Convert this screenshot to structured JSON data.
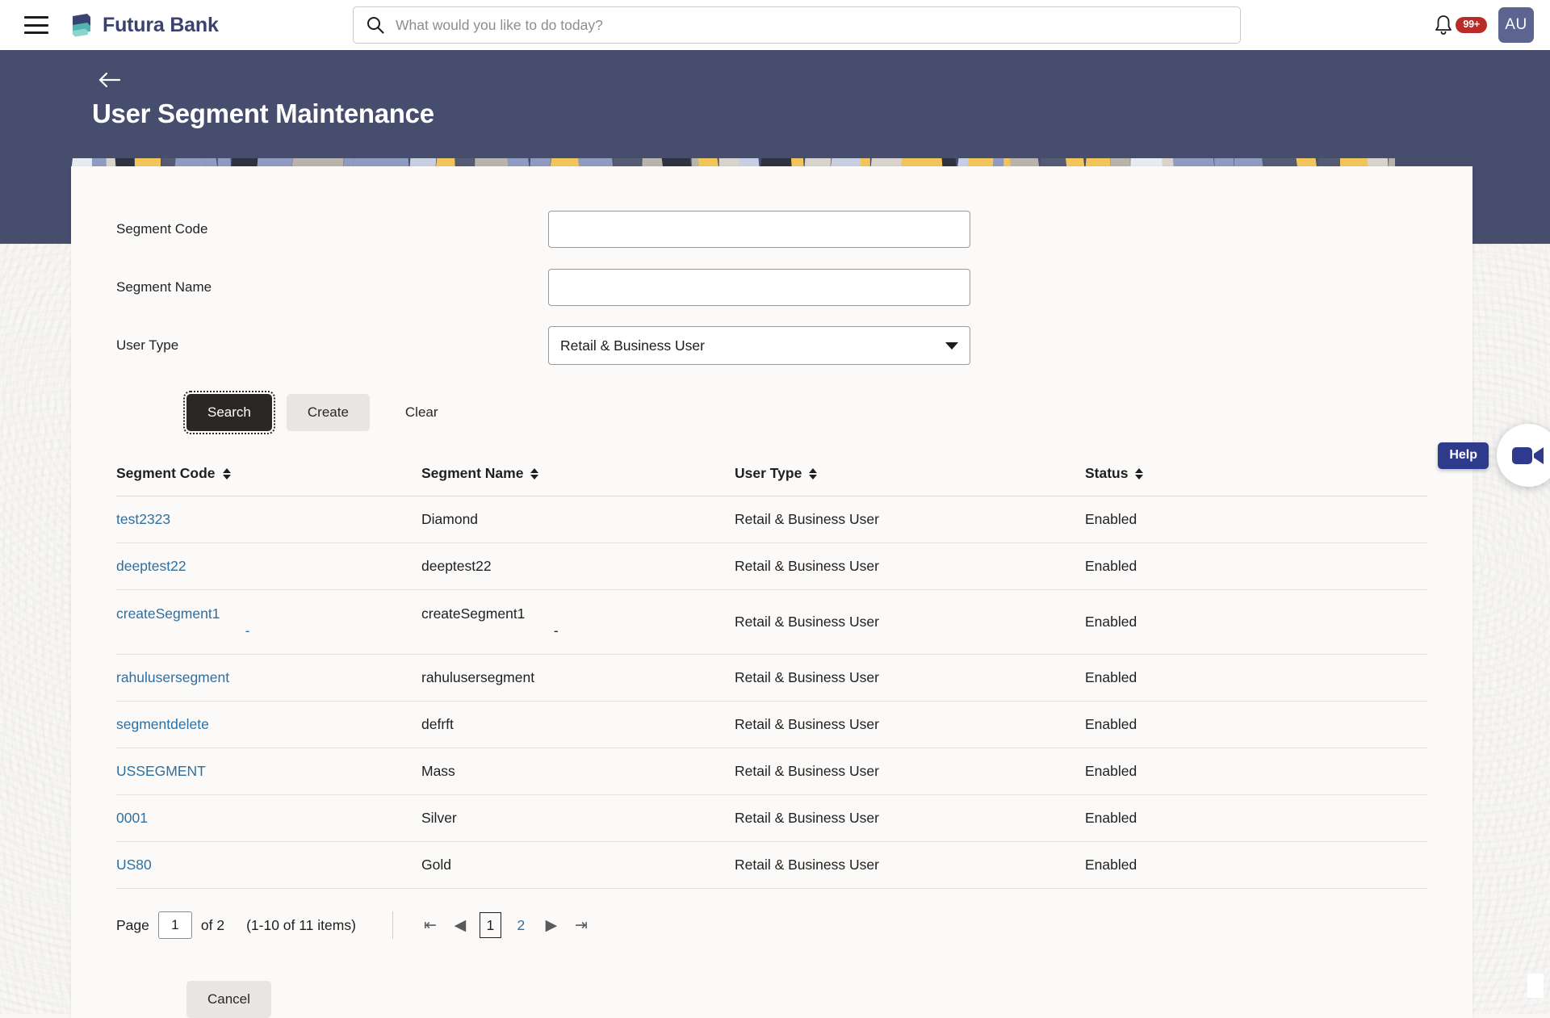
{
  "app": {
    "brand_name": "Futura Bank",
    "menu_icon": "hamburger-icon",
    "logo_icon": "futura-bank-logo"
  },
  "search": {
    "placeholder": "What would you like to do today?",
    "value": "",
    "icon": "search-icon"
  },
  "notifications": {
    "icon": "bell-icon",
    "badge": "99+"
  },
  "user": {
    "initials": "AU",
    "avatar_color": "#5c648f"
  },
  "header": {
    "title": "User Segment Maintenance",
    "back_icon": "arrow-left-icon",
    "band_color": "#474d6d"
  },
  "form": {
    "fields": [
      {
        "label": "Segment Code",
        "value": "",
        "type": "text"
      },
      {
        "label": "Segment Name",
        "value": "",
        "type": "text"
      },
      {
        "label": "User Type",
        "value": "Retail & Business User",
        "type": "select"
      }
    ],
    "user_type_options": [
      "Retail & Business User"
    ]
  },
  "actions": {
    "search_label": "Search",
    "create_label": "Create",
    "clear_label": "Clear",
    "cancel_label": "Cancel"
  },
  "table": {
    "columns": [
      "Segment Code",
      "Segment Name",
      "User Type",
      "Status"
    ],
    "rows": [
      {
        "code": "test2323",
        "name": "Diamond",
        "user_type": "Retail & Business User",
        "status": "Enabled"
      },
      {
        "code": "deeptest22",
        "name": "deeptest22",
        "user_type": "Retail & Business User",
        "status": "Enabled"
      },
      {
        "code": "createSegment1",
        "name": "createSegment1",
        "user_type": "Retail & Business User",
        "status": "Enabled",
        "code_wrap": "-",
        "name_wrap": "-"
      },
      {
        "code": "rahulusersegment",
        "name": "rahulusersegment",
        "user_type": "Retail & Business User",
        "status": "Enabled"
      },
      {
        "code": "segmentdelete",
        "name": "defrft",
        "user_type": "Retail & Business User",
        "status": "Enabled"
      },
      {
        "code": "USSEGMENT",
        "name": "Mass",
        "user_type": "Retail & Business User",
        "status": "Enabled"
      },
      {
        "code": "0001",
        "name": "Silver",
        "user_type": "Retail & Business User",
        "status": "Enabled"
      },
      {
        "code": "US80",
        "name": "Gold",
        "user_type": "Retail & Business User",
        "status": "Enabled"
      }
    ]
  },
  "pagination": {
    "page_label": "Page",
    "page_value": "1",
    "of_label": "of 2",
    "items_label": "(1-10 of 11 items)",
    "first_icon": "first-page-icon",
    "prev_icon": "prev-page-icon",
    "next_icon": "next-page-icon",
    "last_icon": "last-page-icon",
    "pages": [
      "1",
      "2"
    ],
    "current_page": "1"
  },
  "help": {
    "tooltip": "Help",
    "icon": "video-camera-icon",
    "tooltip_color": "#2e3b8c"
  },
  "banner": {
    "colors": [
      "#f2c55c",
      "#c9cfe2",
      "#2f3340",
      "#b9b4ab",
      "#8f9bc0",
      "#e8eaf2",
      "#555b73",
      "#f2c55c",
      "#d8d4cc",
      "#8f9bc0"
    ]
  }
}
